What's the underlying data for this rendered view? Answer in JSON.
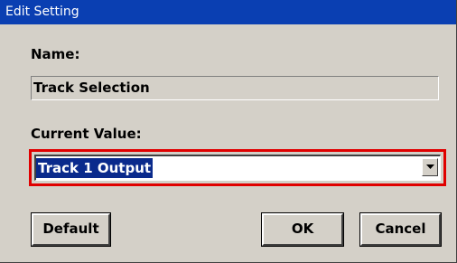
{
  "window": {
    "title": "Edit Setting"
  },
  "form": {
    "name_label": "Name:",
    "name_value": "Track Selection",
    "current_value_label": "Current Value:",
    "current_value": "Track 1 Output"
  },
  "buttons": {
    "default_label": "Default",
    "ok_label": "OK",
    "cancel_label": "Cancel"
  },
  "colors": {
    "titlebar": "#0a3fb2",
    "dialog_background": "#d4d0c8",
    "selection_highlight": "#0a2a8c",
    "annotation_box": "#e00000"
  },
  "icons": {
    "dropdown_arrow": "chevron-down-icon"
  }
}
